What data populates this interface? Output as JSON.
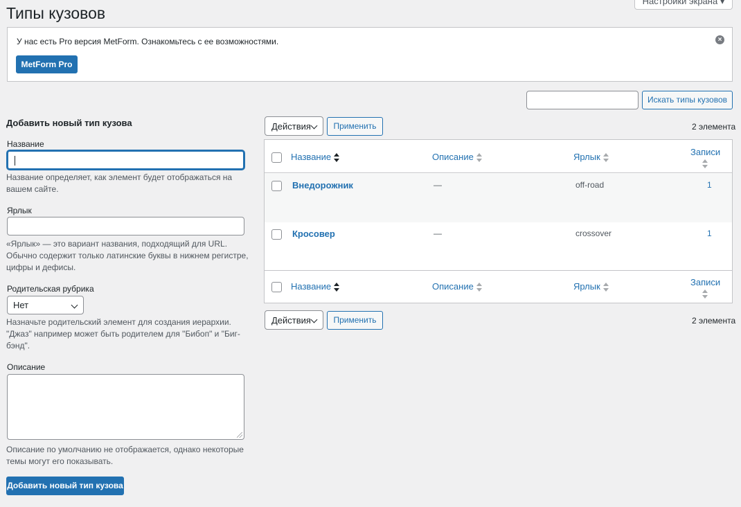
{
  "page": {
    "title": "Типы кузовов",
    "screen_options_label": "Настройки экрана ▾"
  },
  "notice": {
    "text": "У нас есть Pro версия MetForm. Ознакомьтесь с ее возможностями.",
    "button_label": "MetForm Pro",
    "dismiss_icon": "close-icon"
  },
  "search": {
    "value": "",
    "button_label": "Искать типы кузовов"
  },
  "form": {
    "heading": "Добавить новый тип кузова",
    "name": {
      "label": "Название",
      "value": "",
      "help_line1": "Название определяет, как элемент будет отображаться на",
      "help_line2": "вашем сайте."
    },
    "slug": {
      "label": "Ярлык",
      "value": "",
      "help_line1": "«Ярлык» — это вариант названия, подходящий для URL.",
      "help_line2": "Обычно содержит только латинские буквы в нижнем регистре,",
      "help_line3": "цифры и дефисы."
    },
    "parent": {
      "label": "Родительская рубрика",
      "selected": "Нет",
      "help_line1": "Назначьте родительский элемент для создания иерархии.",
      "help_line2": "\"Джаз\" например может быть родителем для \"Бибоп\" и \"Биг-",
      "help_line3": "бэнд\"."
    },
    "description": {
      "label": "Описание",
      "value": "",
      "help_line1": "Описание по умолчанию не отображается, однако некоторые",
      "help_line2": "темы могут его показывать."
    },
    "submit_label": "Добавить новый тип кузова"
  },
  "bulk": {
    "actions_label": "Действия",
    "apply_label": "Применить",
    "count_label": "2 элемента"
  },
  "table": {
    "columns": {
      "name": "Название",
      "description": "Описание",
      "slug": "Ярлык",
      "posts": "Записи"
    },
    "rows": [
      {
        "name": "Внедорожник",
        "description": "—",
        "slug": "off-road",
        "count": "1"
      },
      {
        "name": "Кросовер",
        "description": "—",
        "slug": "crossover",
        "count": "1"
      }
    ]
  },
  "colors": {
    "accent": "#2271b1",
    "background": "#f0f0f1",
    "border": "#c3c4c7"
  }
}
